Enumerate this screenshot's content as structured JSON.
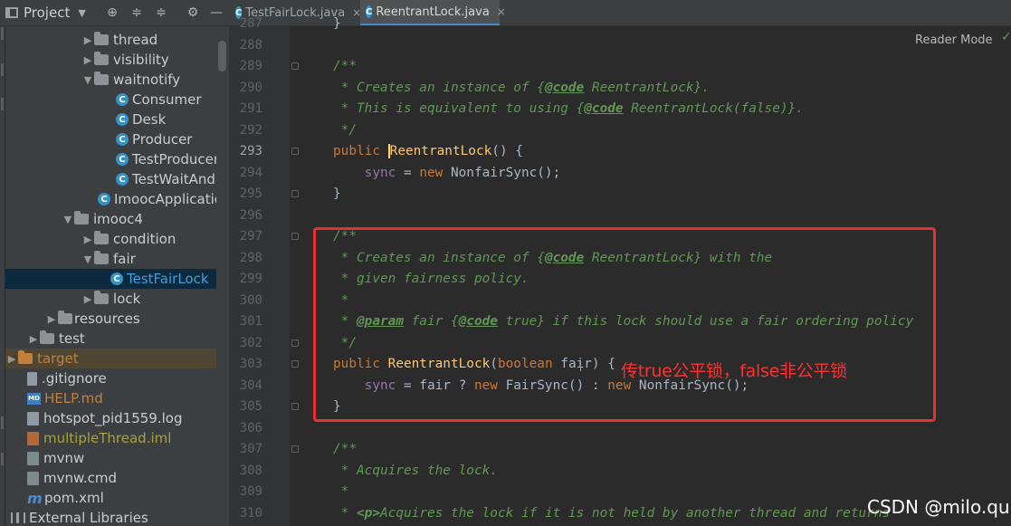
{
  "toolbar": {
    "project_label": "Project",
    "tabs": [
      {
        "label": "TestFairLock.java",
        "close": "×"
      },
      {
        "label": "ReentrantLock.java",
        "close": "×"
      }
    ]
  },
  "tree": {
    "items": [
      {
        "label": "thread",
        "icon": "folder-icon"
      },
      {
        "label": "visibility",
        "icon": "folder-icon"
      },
      {
        "label": "waitnotify",
        "icon": "folder-icon"
      },
      {
        "label": "Consumer",
        "icon": "class-icon"
      },
      {
        "label": "Desk",
        "icon": "class-icon"
      },
      {
        "label": "Producer",
        "icon": "class-icon"
      },
      {
        "label": "TestProducer",
        "icon": "class-icon"
      },
      {
        "label": "TestWaitAndl",
        "icon": "class-icon"
      },
      {
        "label": "ImoocApplicatio",
        "icon": "class-icon"
      },
      {
        "label": "imooc4",
        "icon": "folder-icon"
      },
      {
        "label": "condition",
        "icon": "folder-icon"
      },
      {
        "label": "fair",
        "icon": "folder-icon"
      },
      {
        "label": "TestFairLock",
        "icon": "class-icon"
      },
      {
        "label": "lock",
        "icon": "folder-icon"
      },
      {
        "label": "resources",
        "icon": "folder-icon"
      },
      {
        "label": "test",
        "icon": "folder-icon"
      },
      {
        "label": "target",
        "icon": "folder-icon"
      },
      {
        "label": ".gitignore",
        "icon": "file-icon"
      },
      {
        "label": "HELP.md",
        "icon": "markdown-icon"
      },
      {
        "label": "hotspot_pid1559.log",
        "icon": "file-icon"
      },
      {
        "label": "multipleThread.iml",
        "icon": "file-icon"
      },
      {
        "label": "mvnw",
        "icon": "file-icon"
      },
      {
        "label": "mvnw.cmd",
        "icon": "file-icon"
      },
      {
        "label": "pom.xml",
        "icon": "maven-icon"
      },
      {
        "label": "External Libraries",
        "icon": "libraries-icon"
      }
    ],
    "selected": "TestFairLock",
    "colors": {
      "selected_bg": "#0d293e",
      "excluded": "#c37f3b",
      "md_text": "#c37f3b",
      "iml_text": "#a8a13c"
    }
  },
  "editor": {
    "reader_mode": "Reader Mode",
    "line_numbers": [
      "287",
      "288",
      "289",
      "290",
      "291",
      "292",
      "293",
      "294",
      "295",
      "296",
      "297",
      "298",
      "299",
      "300",
      "301",
      "302",
      "303",
      "304",
      "305",
      "306",
      "307",
      "308",
      "309",
      "310"
    ],
    "current_line": "293",
    "code": {
      "l287": "}",
      "l289": "/**",
      "l290a": " * Creates an instance of {",
      "l290b": "@code",
      "l290c": " ReentrantLock}.",
      "l291a": " * This is equivalent to using {",
      "l291b": "@code",
      "l291c": " ReentrantLock(false)}.",
      "l292": " */",
      "l293a": "public ",
      "l293b": "ReentrantLock",
      "l293c": "() {",
      "l294a": "    ",
      "l294b": "sync",
      "l294c": " = ",
      "l294d": "new ",
      "l294e": "NonfairSync();",
      "l295": "}",
      "l297": "/**",
      "l298a": " * Creates an instance of {",
      "l298b": "@code",
      "l298c": " ReentrantLock} with the",
      "l299": " * given fairness policy.",
      "l300": " *",
      "l301a": " * ",
      "l301b": "@param",
      "l301c": " fair {",
      "l301d": "@code",
      "l301e": " true} if this lock should use a fair ordering policy",
      "l302": " */",
      "l303a": "public ",
      "l303b": "ReentrantLock",
      "l303c": "(",
      "l303d": "boolean ",
      "l303e": "fair) {",
      "l304a": "    ",
      "l304b": "sync",
      "l304c": " = fair ? ",
      "l304d": "new ",
      "l304e": "FairSync() : ",
      "l304f": "new ",
      "l304g": "NonfairSync();",
      "l305": "}",
      "l307": "/**",
      "l308": " * Acquires the lock.",
      "l309": " *",
      "l310a": " * ",
      "l310b": "<p>",
      "l310c": "Acquires the lock if it is not held by another thread and returns"
    }
  },
  "annotation": {
    "text": "传true公平锁，false非公平锁",
    "color": "#ff3030"
  },
  "watermark": "CSDN @milo.qu"
}
